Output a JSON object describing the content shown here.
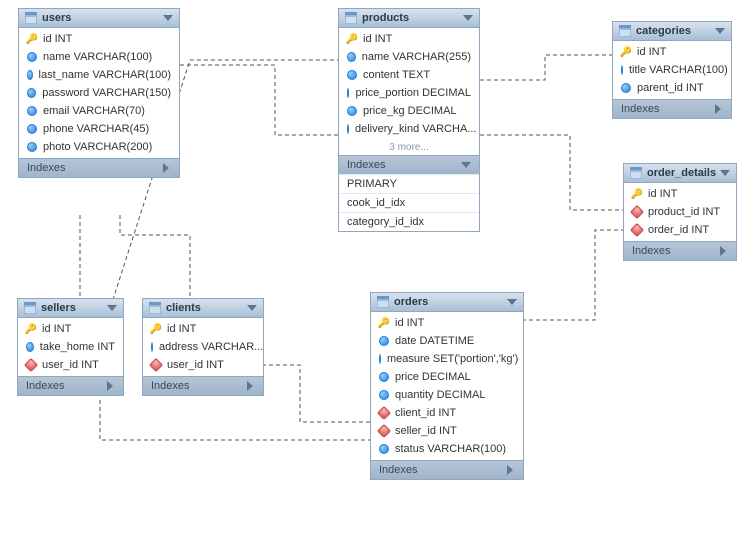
{
  "tables": {
    "users": {
      "title": "users",
      "cols": [
        {
          "k": "key",
          "t": "id INT"
        },
        {
          "k": "blue",
          "t": "name VARCHAR(100)"
        },
        {
          "k": "blue",
          "t": "last_name VARCHAR(100)"
        },
        {
          "k": "blue",
          "t": "password VARCHAR(150)"
        },
        {
          "k": "blue",
          "t": "email VARCHAR(70)"
        },
        {
          "k": "blue",
          "t": "phone VARCHAR(45)"
        },
        {
          "k": "blue",
          "t": "photo VARCHAR(200)"
        }
      ],
      "indexes_label": "Indexes"
    },
    "products": {
      "title": "products",
      "cols": [
        {
          "k": "key",
          "t": "id INT"
        },
        {
          "k": "blue",
          "t": "name VARCHAR(255)"
        },
        {
          "k": "blue",
          "t": "content TEXT"
        },
        {
          "k": "blue",
          "t": "price_portion DECIMAL"
        },
        {
          "k": "blue",
          "t": "price_kg DECIMAL"
        },
        {
          "k": "blue",
          "t": "delivery_kind VARCHA..."
        }
      ],
      "more": "3 more...",
      "indexes_label": "Indexes",
      "indexes": [
        "PRIMARY",
        "cook_id_idx",
        "category_id_idx"
      ]
    },
    "categories": {
      "title": "categories",
      "cols": [
        {
          "k": "key",
          "t": "id INT"
        },
        {
          "k": "blue",
          "t": "title VARCHAR(100)"
        },
        {
          "k": "blue",
          "t": "parent_id INT"
        }
      ],
      "indexes_label": "Indexes"
    },
    "order_details": {
      "title": "order_details",
      "cols": [
        {
          "k": "key",
          "t": "id INT"
        },
        {
          "k": "red",
          "t": "product_id INT"
        },
        {
          "k": "red",
          "t": "order_id INT"
        }
      ],
      "indexes_label": "Indexes"
    },
    "sellers": {
      "title": "sellers",
      "cols": [
        {
          "k": "key",
          "t": "id INT"
        },
        {
          "k": "blue",
          "t": "take_home INT"
        },
        {
          "k": "red",
          "t": "user_id INT"
        }
      ],
      "indexes_label": "Indexes"
    },
    "clients": {
      "title": "clients",
      "cols": [
        {
          "k": "key",
          "t": "id INT"
        },
        {
          "k": "blue",
          "t": "address VARCHAR..."
        },
        {
          "k": "red",
          "t": "user_id INT"
        }
      ],
      "indexes_label": "Indexes"
    },
    "orders": {
      "title": "orders",
      "cols": [
        {
          "k": "key",
          "t": "id INT"
        },
        {
          "k": "blue",
          "t": "date DATETIME"
        },
        {
          "k": "blue",
          "t": "measure SET('portion','kg')"
        },
        {
          "k": "blue",
          "t": "price DECIMAL"
        },
        {
          "k": "blue",
          "t": "quantity DECIMAL"
        },
        {
          "k": "red",
          "t": "client_id INT"
        },
        {
          "k": "red",
          "t": "seller_id INT"
        },
        {
          "k": "blue",
          "t": "status VARCHAR(100)"
        }
      ],
      "indexes_label": "Indexes"
    }
  }
}
